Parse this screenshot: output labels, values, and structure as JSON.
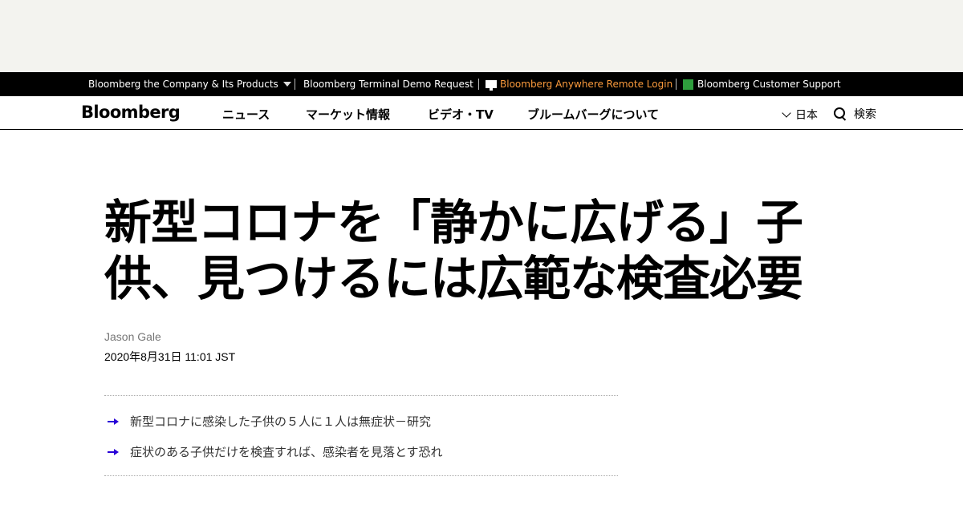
{
  "top_strip": {
    "company_label": "Bloomberg the Company & Its Products",
    "terminal_demo_label": "Bloomberg Terminal Demo Request",
    "anywhere_label": "Bloomberg Anywhere Remote Login",
    "support_label": "Bloomberg Customer Support"
  },
  "nav": {
    "logo": "Bloomberg",
    "links": [
      "ニュース",
      "マーケット情報",
      "ビデオ・TV",
      "ブルームバーグについて"
    ],
    "language": "日本",
    "search_label": "検索"
  },
  "article": {
    "headline_line1": "新型コロナを「静かに広げる」子",
    "headline_line2": "供、見つけるには広範な検査必要",
    "author": "Jason Gale",
    "timestamp": "2020年8月31日 11:01 JST",
    "abstract": [
      "新型コロナに感染した子供の５人に１人は無症状－研究",
      "症状のある子供だけを検査すれば、感染者を見落とす恐れ"
    ]
  },
  "colors": {
    "ad_background": "#f3f3ef",
    "top_strip_background": "#000000",
    "highlight_link": "#fa9a3c",
    "arrow": "#2800d7",
    "support_icon": "#2e9e3d"
  }
}
